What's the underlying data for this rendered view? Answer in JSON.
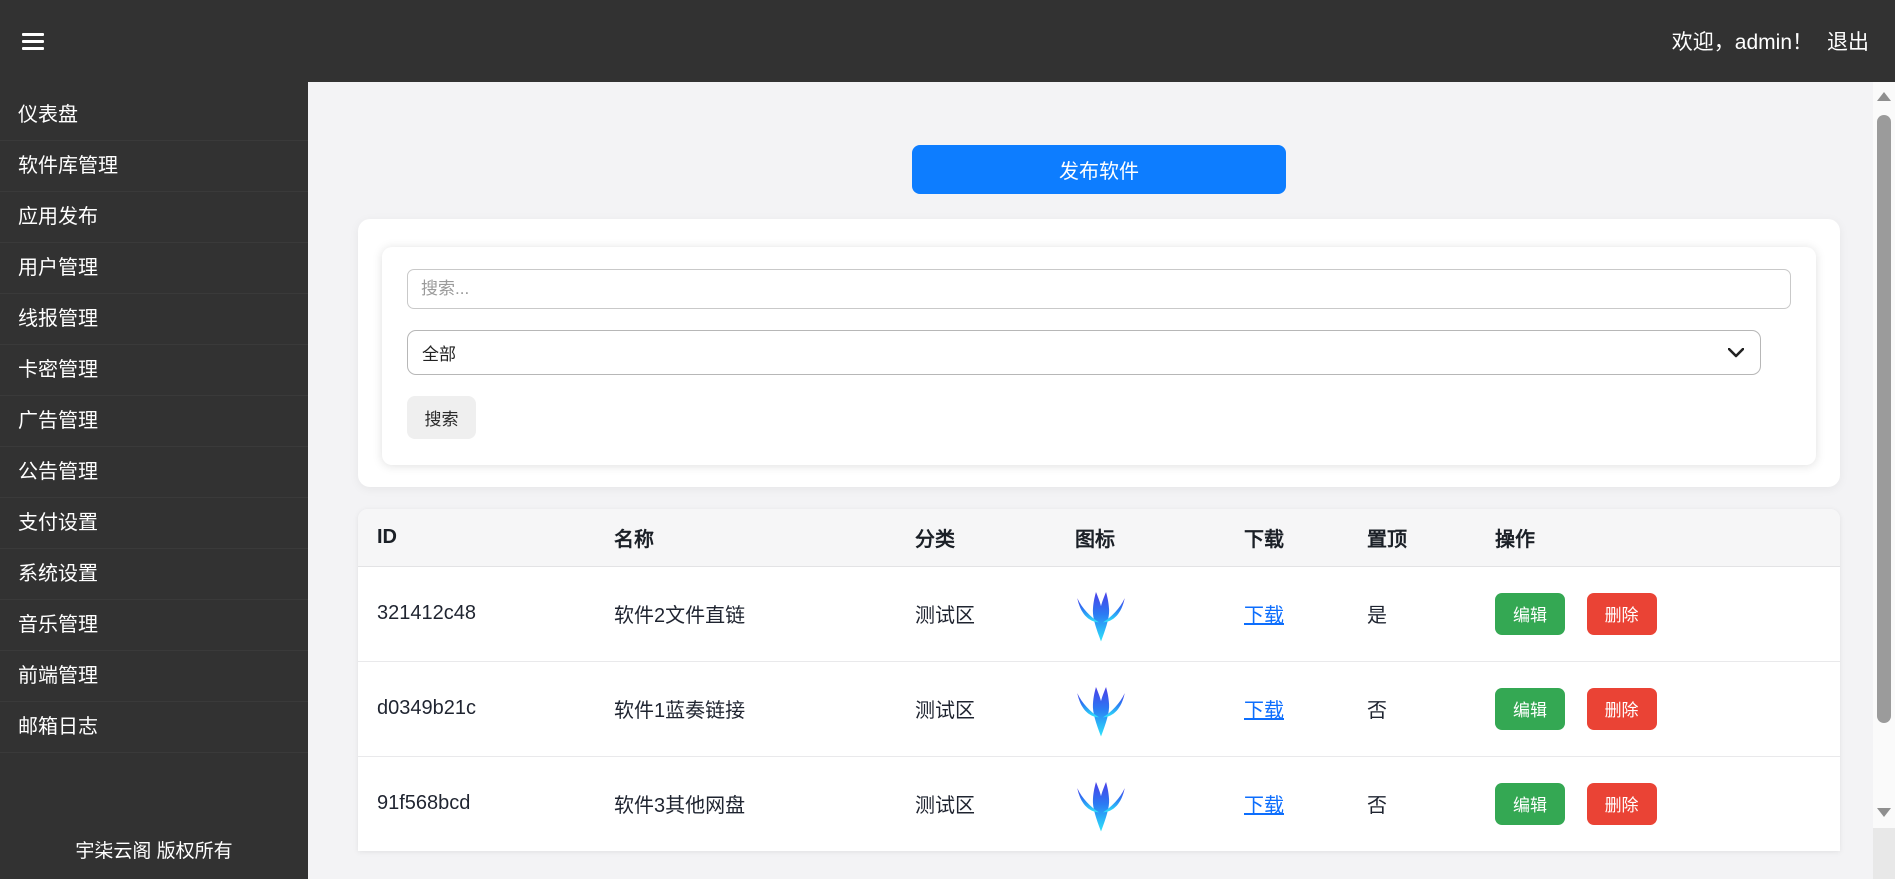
{
  "topbar": {
    "welcome": "欢迎，admin！",
    "logout": "退出"
  },
  "sidebar": {
    "items": [
      "仪表盘",
      "软件库管理",
      "应用发布",
      "用户管理",
      "线报管理",
      "卡密管理",
      "广告管理",
      "公告管理",
      "支付设置",
      "系统设置",
      "音乐管理",
      "前端管理",
      "邮箱日志"
    ],
    "footer": "宇柒云阁 版权所有"
  },
  "main": {
    "publish_button": "发布软件",
    "search": {
      "placeholder": "搜索...",
      "category_selected": "全部",
      "submit_label": "搜索"
    },
    "table": {
      "columns": [
        "ID",
        "名称",
        "分类",
        "图标",
        "下载",
        "置顶",
        "操作"
      ],
      "edit_label": "编辑",
      "delete_label": "删除",
      "rows": [
        {
          "id": "321412c48",
          "name": "软件2文件直链",
          "category": "测试区",
          "icon": "blue-phoenix-logo",
          "download": "下载",
          "pinned": "是"
        },
        {
          "id": "d0349b21c",
          "name": "软件1蓝奏链接",
          "category": "测试区",
          "icon": "blue-phoenix-logo",
          "download": "下载",
          "pinned": "否"
        },
        {
          "id": "91f568bcd",
          "name": "软件3其他网盘",
          "category": "测试区",
          "icon": "blue-phoenix-logo",
          "download": "下载",
          "pinned": "否"
        }
      ]
    }
  },
  "colors": {
    "topbar_bg": "#323232",
    "primary": "#0d7dff",
    "success": "#34a853",
    "danger": "#ea4335",
    "link": "#0d6efd"
  }
}
